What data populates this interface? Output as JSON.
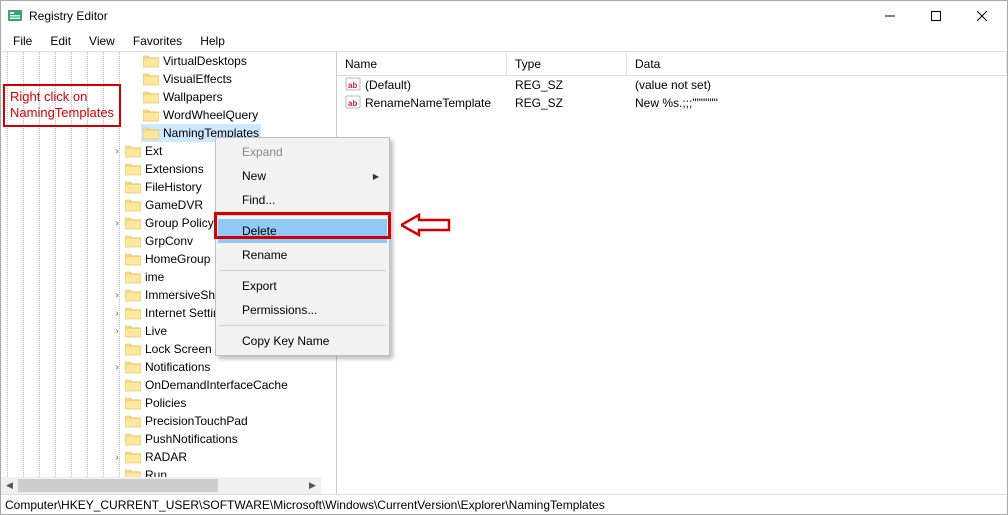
{
  "window": {
    "title": "Registry Editor"
  },
  "menubar": [
    "File",
    "Edit",
    "View",
    "Favorites",
    "Help"
  ],
  "tree": {
    "level2_items": [
      {
        "label": "VirtualDesktops",
        "expandable": false
      },
      {
        "label": "VisualEffects",
        "expandable": false
      },
      {
        "label": "Wallpapers",
        "expandable": false
      },
      {
        "label": "WordWheelQuery",
        "expandable": false
      },
      {
        "label": "NamingTemplates",
        "expandable": false,
        "selected": true
      }
    ],
    "level1_items": [
      {
        "label": "Ext",
        "expandable": true
      },
      {
        "label": "Extensions",
        "expandable": false
      },
      {
        "label": "FileHistory",
        "expandable": false
      },
      {
        "label": "GameDVR",
        "expandable": false
      },
      {
        "label": "Group Policy",
        "expandable": true
      },
      {
        "label": "GrpConv",
        "expandable": false
      },
      {
        "label": "HomeGroup",
        "expandable": false
      },
      {
        "label": "ime",
        "expandable": false
      },
      {
        "label": "ImmersiveShell",
        "expandable": true
      },
      {
        "label": "Internet Settings",
        "expandable": true
      },
      {
        "label": "Live",
        "expandable": true
      },
      {
        "label": "Lock Screen",
        "expandable": false
      },
      {
        "label": "Notifications",
        "expandable": true
      },
      {
        "label": "OnDemandInterfaceCache",
        "expandable": false
      },
      {
        "label": "Policies",
        "expandable": false
      },
      {
        "label": "PrecisionTouchPad",
        "expandable": false
      },
      {
        "label": "PushNotifications",
        "expandable": false
      },
      {
        "label": "RADAR",
        "expandable": true
      },
      {
        "label": "Run",
        "expandable": false
      }
    ]
  },
  "list": {
    "columns": {
      "name": "Name",
      "type": "Type",
      "data": "Data"
    },
    "rows": [
      {
        "name": "(Default)",
        "type": "REG_SZ",
        "data": "(value not set)",
        "icon": "string"
      },
      {
        "name": "RenameNameTemplate",
        "type": "REG_SZ",
        "data": "New %s.;;;\"\"\"\"\"\"",
        "icon": "string"
      }
    ]
  },
  "context_menu": {
    "items": [
      {
        "label": "Expand",
        "disabled": true
      },
      {
        "label": "New",
        "submenu": true
      },
      {
        "label": "Find..."
      },
      {
        "sep": true
      },
      {
        "label": "Delete",
        "highlighted": true
      },
      {
        "label": "Rename"
      },
      {
        "sep": true
      },
      {
        "label": "Export"
      },
      {
        "label": "Permissions..."
      },
      {
        "sep": true
      },
      {
        "label": "Copy Key Name"
      }
    ]
  },
  "statusbar": "Computer\\HKEY_CURRENT_USER\\SOFTWARE\\Microsoft\\Windows\\CurrentVersion\\Explorer\\NamingTemplates",
  "annotation": {
    "line1": "Right click on",
    "line2": "NamingTemplates"
  }
}
